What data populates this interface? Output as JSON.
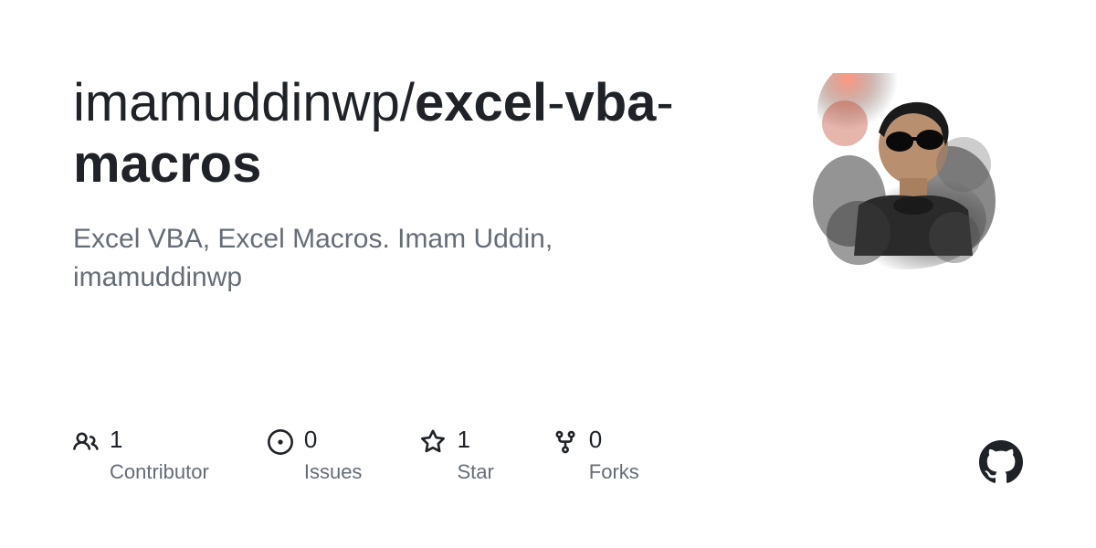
{
  "repo": {
    "owner": "imamuddinwp",
    "slash": "/",
    "name_part1": "excel",
    "hyphen1": "-",
    "name_part2": "vba",
    "hyphen2": "-",
    "name_part3": "macros",
    "description": "Excel VBA, Excel Macros. Imam Uddin, imamuddinwp"
  },
  "stats": {
    "contributors": {
      "count": "1",
      "label": "Contributor"
    },
    "issues": {
      "count": "0",
      "label": "Issues"
    },
    "stars": {
      "count": "1",
      "label": "Star"
    },
    "forks": {
      "count": "0",
      "label": "Forks"
    }
  }
}
